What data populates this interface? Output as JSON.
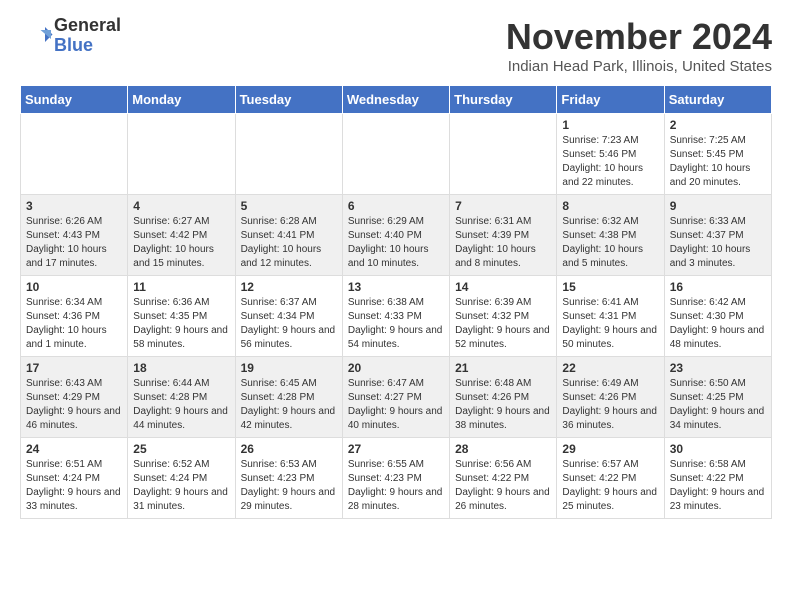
{
  "logo": {
    "line1": "General",
    "line2": "Blue"
  },
  "title": "November 2024",
  "location": "Indian Head Park, Illinois, United States",
  "weekdays": [
    "Sunday",
    "Monday",
    "Tuesday",
    "Wednesday",
    "Thursday",
    "Friday",
    "Saturday"
  ],
  "rows": [
    [
      {
        "day": "",
        "info": ""
      },
      {
        "day": "",
        "info": ""
      },
      {
        "day": "",
        "info": ""
      },
      {
        "day": "",
        "info": ""
      },
      {
        "day": "",
        "info": ""
      },
      {
        "day": "1",
        "info": "Sunrise: 7:23 AM\nSunset: 5:46 PM\nDaylight: 10 hours and 22 minutes."
      },
      {
        "day": "2",
        "info": "Sunrise: 7:25 AM\nSunset: 5:45 PM\nDaylight: 10 hours and 20 minutes."
      }
    ],
    [
      {
        "day": "3",
        "info": "Sunrise: 6:26 AM\nSunset: 4:43 PM\nDaylight: 10 hours and 17 minutes."
      },
      {
        "day": "4",
        "info": "Sunrise: 6:27 AM\nSunset: 4:42 PM\nDaylight: 10 hours and 15 minutes."
      },
      {
        "day": "5",
        "info": "Sunrise: 6:28 AM\nSunset: 4:41 PM\nDaylight: 10 hours and 12 minutes."
      },
      {
        "day": "6",
        "info": "Sunrise: 6:29 AM\nSunset: 4:40 PM\nDaylight: 10 hours and 10 minutes."
      },
      {
        "day": "7",
        "info": "Sunrise: 6:31 AM\nSunset: 4:39 PM\nDaylight: 10 hours and 8 minutes."
      },
      {
        "day": "8",
        "info": "Sunrise: 6:32 AM\nSunset: 4:38 PM\nDaylight: 10 hours and 5 minutes."
      },
      {
        "day": "9",
        "info": "Sunrise: 6:33 AM\nSunset: 4:37 PM\nDaylight: 10 hours and 3 minutes."
      }
    ],
    [
      {
        "day": "10",
        "info": "Sunrise: 6:34 AM\nSunset: 4:36 PM\nDaylight: 10 hours and 1 minute."
      },
      {
        "day": "11",
        "info": "Sunrise: 6:36 AM\nSunset: 4:35 PM\nDaylight: 9 hours and 58 minutes."
      },
      {
        "day": "12",
        "info": "Sunrise: 6:37 AM\nSunset: 4:34 PM\nDaylight: 9 hours and 56 minutes."
      },
      {
        "day": "13",
        "info": "Sunrise: 6:38 AM\nSunset: 4:33 PM\nDaylight: 9 hours and 54 minutes."
      },
      {
        "day": "14",
        "info": "Sunrise: 6:39 AM\nSunset: 4:32 PM\nDaylight: 9 hours and 52 minutes."
      },
      {
        "day": "15",
        "info": "Sunrise: 6:41 AM\nSunset: 4:31 PM\nDaylight: 9 hours and 50 minutes."
      },
      {
        "day": "16",
        "info": "Sunrise: 6:42 AM\nSunset: 4:30 PM\nDaylight: 9 hours and 48 minutes."
      }
    ],
    [
      {
        "day": "17",
        "info": "Sunrise: 6:43 AM\nSunset: 4:29 PM\nDaylight: 9 hours and 46 minutes."
      },
      {
        "day": "18",
        "info": "Sunrise: 6:44 AM\nSunset: 4:28 PM\nDaylight: 9 hours and 44 minutes."
      },
      {
        "day": "19",
        "info": "Sunrise: 6:45 AM\nSunset: 4:28 PM\nDaylight: 9 hours and 42 minutes."
      },
      {
        "day": "20",
        "info": "Sunrise: 6:47 AM\nSunset: 4:27 PM\nDaylight: 9 hours and 40 minutes."
      },
      {
        "day": "21",
        "info": "Sunrise: 6:48 AM\nSunset: 4:26 PM\nDaylight: 9 hours and 38 minutes."
      },
      {
        "day": "22",
        "info": "Sunrise: 6:49 AM\nSunset: 4:26 PM\nDaylight: 9 hours and 36 minutes."
      },
      {
        "day": "23",
        "info": "Sunrise: 6:50 AM\nSunset: 4:25 PM\nDaylight: 9 hours and 34 minutes."
      }
    ],
    [
      {
        "day": "24",
        "info": "Sunrise: 6:51 AM\nSunset: 4:24 PM\nDaylight: 9 hours and 33 minutes."
      },
      {
        "day": "25",
        "info": "Sunrise: 6:52 AM\nSunset: 4:24 PM\nDaylight: 9 hours and 31 minutes."
      },
      {
        "day": "26",
        "info": "Sunrise: 6:53 AM\nSunset: 4:23 PM\nDaylight: 9 hours and 29 minutes."
      },
      {
        "day": "27",
        "info": "Sunrise: 6:55 AM\nSunset: 4:23 PM\nDaylight: 9 hours and 28 minutes."
      },
      {
        "day": "28",
        "info": "Sunrise: 6:56 AM\nSunset: 4:22 PM\nDaylight: 9 hours and 26 minutes."
      },
      {
        "day": "29",
        "info": "Sunrise: 6:57 AM\nSunset: 4:22 PM\nDaylight: 9 hours and 25 minutes."
      },
      {
        "day": "30",
        "info": "Sunrise: 6:58 AM\nSunset: 4:22 PM\nDaylight: 9 hours and 23 minutes."
      }
    ]
  ]
}
